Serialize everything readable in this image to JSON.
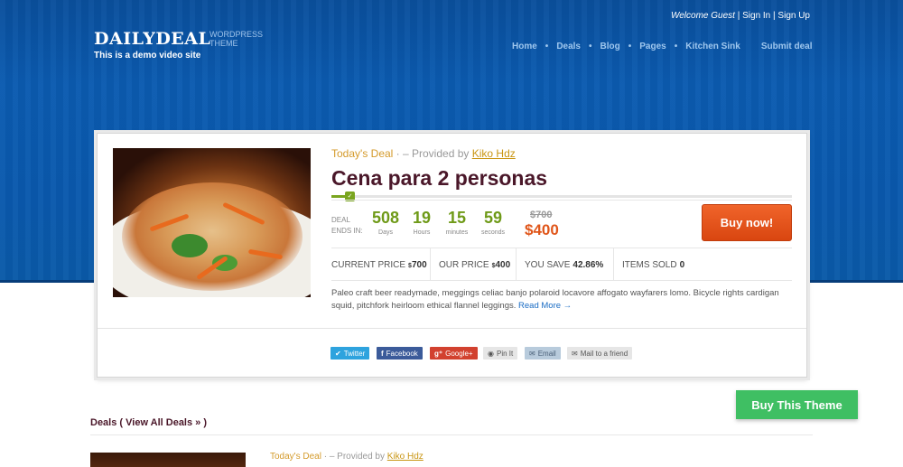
{
  "header": {
    "logo_main": "DAILYDEAL",
    "logo_sub": "WordPress Theme",
    "tagline": "This is a demo video site",
    "welcome_text": "Welcome Guest",
    "sign_in": "Sign In",
    "sign_up": "Sign Up",
    "separator": "|",
    "nav": [
      "Home",
      "Deals",
      "Blog",
      "Pages",
      "Kitchen Sink",
      "Submit deal"
    ]
  },
  "deal": {
    "today_label": "Today's Deal",
    "provided_by_text": "· – Provided by",
    "provider": "Kiko Hdz",
    "title": "Cena para 2 personas",
    "progress_fraction": 0.04,
    "ends_label_1": "Deal",
    "ends_label_2": "Ends in:",
    "countdown": [
      {
        "value": "508",
        "unit": "Days"
      },
      {
        "value": "19",
        "unit": "Hours"
      },
      {
        "value": "15",
        "unit": "minutes"
      },
      {
        "value": "59",
        "unit": "seconds"
      }
    ],
    "old_price": "$700",
    "new_price": "$400",
    "buy_label": "Buy now!",
    "stats": [
      {
        "label": "CURRENT PRICE",
        "currency": "$",
        "value": "700"
      },
      {
        "label": "OUR PRICE",
        "currency": "$",
        "value": "400"
      },
      {
        "label": "YOU SAVE",
        "currency": "",
        "value": "42.86%"
      },
      {
        "label": "ITEMS SOLD",
        "currency": "",
        "value": "0"
      }
    ],
    "description": "Paleo craft beer readymade, meggings celiac banjo polaroid locavore affogato wayfarers lomo. Bicycle rights cardigan squid, pitchfork heirloom ethical flannel leggings.",
    "read_more": "Read More →"
  },
  "share": [
    {
      "label": "Twitter",
      "icon": "twitter-icon",
      "glyph": "🐦",
      "color": "#2ea3de"
    },
    {
      "label": "Facebook",
      "icon": "facebook-icon",
      "glyph": "f",
      "color": "#3b5b9a"
    },
    {
      "label": "Google+",
      "icon": "google-plus-icon",
      "glyph": "g⁺",
      "color": "#d2412f"
    },
    {
      "label": "Pin It",
      "icon": "pinterest-icon",
      "glyph": "◉",
      "color": "#e4e4e4"
    },
    {
      "label": "Email",
      "icon": "email-icon",
      "glyph": "✉",
      "color": "#b8c8d8"
    },
    {
      "label": "Mail to a friend",
      "icon": "mail-icon",
      "glyph": "✉",
      "color": "#e4e4e4"
    }
  ],
  "buy_theme": "Buy This Theme",
  "deals_heading": "Deals ( View All Deals » )",
  "next_deal": {
    "today_label": "Today's Deal",
    "provided_by_text": "· – Provided by",
    "provider": "Kiko Hdz"
  }
}
